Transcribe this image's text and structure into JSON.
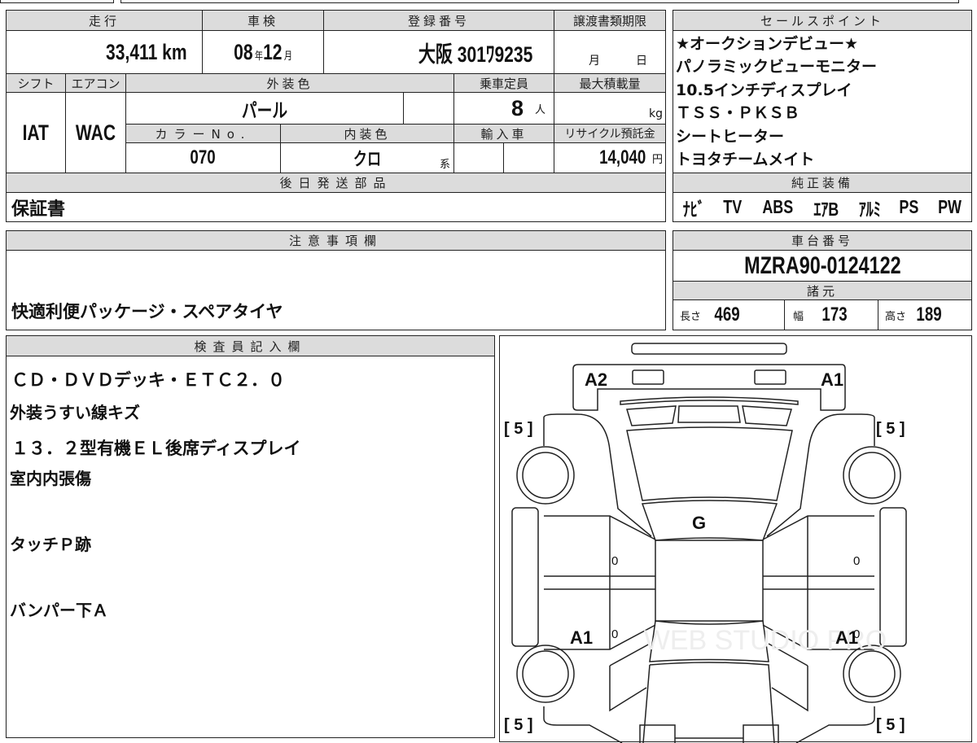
{
  "vehicle": {
    "mileage_label": "走行",
    "mileage": "33,411",
    "mileage_unit": "km",
    "inspection_label": "車検",
    "inspection_year": "08",
    "year_unit": "年",
    "inspection_month": "12",
    "month_unit": "月",
    "registration_label": "登録番号",
    "registration": "大阪 301ﾜ9235",
    "transfer_deadline_label": "譲渡書類期限",
    "transfer_month_unit": "月",
    "transfer_day_unit": "日",
    "shift_label": "シフト",
    "shift": "IAT",
    "ac_label": "エアコン",
    "ac": "WAC",
    "exterior_color_label": "外装色",
    "exterior_color": "パール",
    "capacity_label": "乗車定員",
    "capacity": "8",
    "capacity_unit": "人",
    "max_load_label": "最大積載量",
    "max_load_unit": "kg",
    "color_no_label": "カラーNo.",
    "color_no": "070",
    "interior_color_label": "内装色",
    "interior_color": "クロ",
    "interior_suffix": "系",
    "import_label": "輸入車",
    "recycle_label": "リサイクル預託金",
    "recycle_fee": "14,040",
    "recycle_unit": "円",
    "later_parts_label": "後日発送部品",
    "later_parts": "保証書"
  },
  "sales_points": {
    "label": "セールスポイント",
    "lines": [
      "★オークションデビュー★",
      "パノラミックビューモニター",
      "10.5インチディスプレイ",
      "ＴＳＳ・ＰＫＳＢ",
      "シートヒーター",
      "トヨタチームメイト"
    ]
  },
  "equipment": {
    "label": "純正装備",
    "items": [
      "ﾅﾋﾞ",
      "TV",
      "ABS",
      "ｴｱB",
      "ｱﾙﾐ",
      "PS",
      "PW"
    ]
  },
  "notes": {
    "label": "注意事項欄",
    "lines": [
      "快適利便パッケージ・スペアタイヤ",
      "ＣＤ・ＤＶＤデッキ・ＥＴＣ２．０",
      "１３．２型有機ＥＬ後席ディスプレイ"
    ]
  },
  "chassis": {
    "label": "車台番号",
    "number": "MZRA90-0124122",
    "specs_label": "諸元",
    "length_label": "長さ",
    "length": "469",
    "width_label": "幅",
    "width": "173",
    "height_label": "高さ",
    "height": "189"
  },
  "inspector": {
    "label": "検査員記入欄",
    "lines": [
      "外装うすい線キズ",
      "室内内張傷",
      "タッチＰ跡",
      "バンパー下Ａ"
    ]
  },
  "diagram": {
    "front_left": "A2",
    "front_right": "A1",
    "roof": "G",
    "rear_left": "A1",
    "rear_right": "A1",
    "door_mark": "0",
    "tire_mark": "[ 5 ]",
    "watermark": "WEB STUDIO PRO"
  }
}
